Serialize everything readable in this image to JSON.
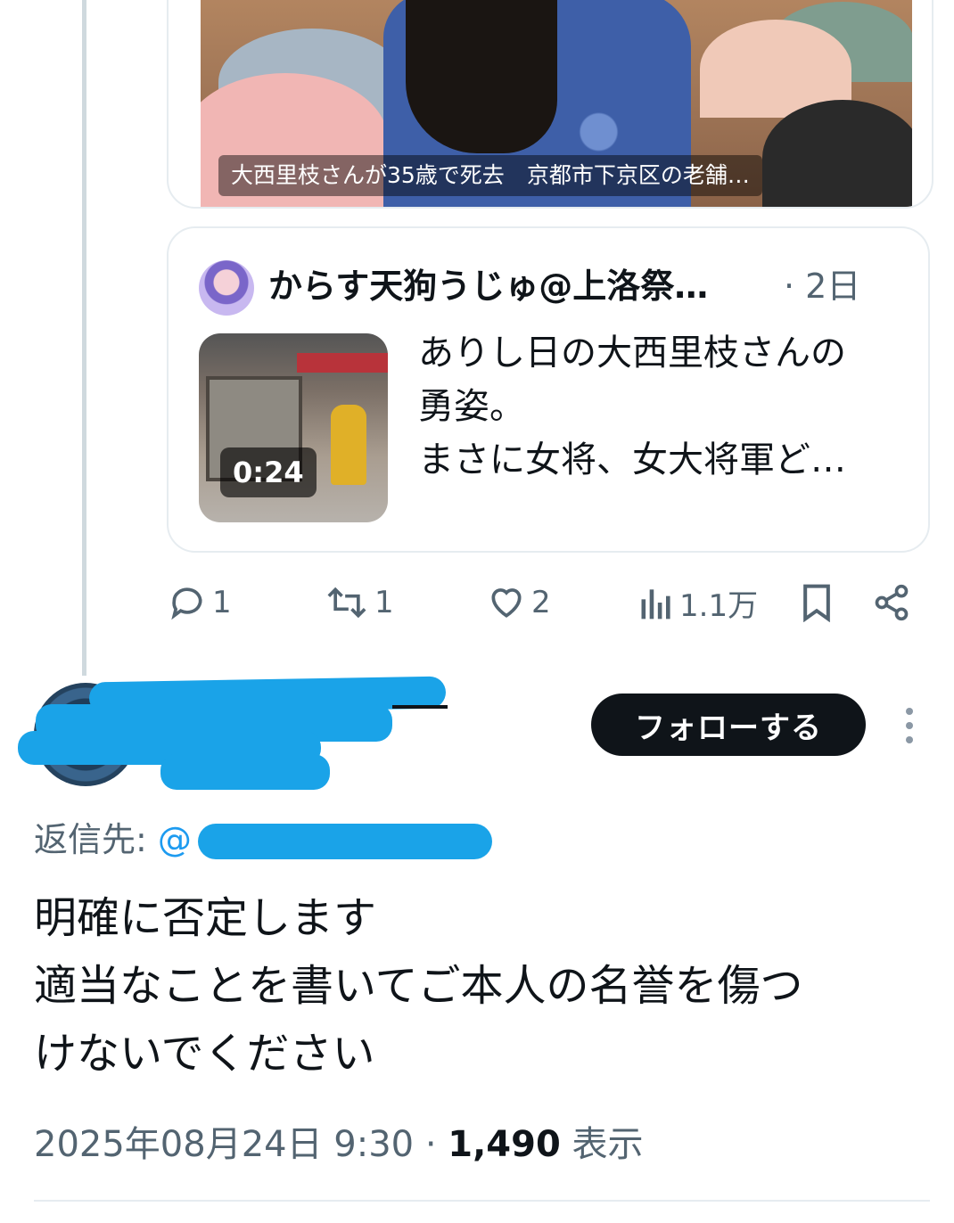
{
  "article_card": {
    "headline": "大西里枝さんが35歳で死去　京都市下京区の老舗…"
  },
  "quoted_tweet": {
    "author": "からす天狗うじゅ@上洛祭…",
    "time": "· 2日",
    "video_duration": "0:24",
    "text_lines": [
      "ありし日の大西里枝さんの",
      "勇姿。",
      "まさに女将、女大将軍ど…"
    ]
  },
  "actions": {
    "reply": {
      "icon": "reply-icon",
      "count": "1"
    },
    "retweet": {
      "icon": "retweet-icon",
      "count": "1"
    },
    "like": {
      "icon": "heart-icon",
      "count": "2"
    },
    "views": {
      "icon": "bar-chart-icon",
      "count": "1.1万"
    },
    "bookmark": {
      "icon": "bookmark-icon"
    },
    "share": {
      "icon": "share-icon"
    }
  },
  "reply_tweet": {
    "display_name": "",
    "handle": "",
    "follow_label": "フォローする",
    "reply_to_label": "返信先:",
    "reply_to_mention": "@",
    "text_lines": [
      "明確に否定します",
      "適当なことを書いてご本人の名誉を傷つ",
      "けないでください"
    ],
    "timestamp": "2025年08月24日 9:30 · ",
    "view_count": "1,490",
    "view_label": " 表示"
  },
  "colors": {
    "accent": "#1d9bf0",
    "secondary_text": "#536471",
    "primary_text": "#0f1419",
    "follow_bg": "#0f1419",
    "redaction": "#1aa3e8"
  }
}
